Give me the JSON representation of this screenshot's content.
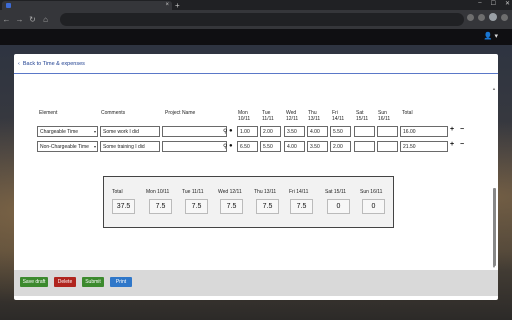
{
  "browser": {
    "tab_close": "×",
    "new_tab": "+"
  },
  "back_link": "Back to Time & expenses",
  "columns": {
    "element": "Element",
    "comments": "Comments",
    "project": "Project Name",
    "days": [
      {
        "day": "Mon",
        "date": "10/11"
      },
      {
        "day": "Tue",
        "date": "11/11"
      },
      {
        "day": "Wed",
        "date": "12/11"
      },
      {
        "day": "Thu",
        "date": "13/11"
      },
      {
        "day": "Fri",
        "date": "14/11"
      },
      {
        "day": "Sat",
        "date": "15/11"
      },
      {
        "day": "Sun",
        "date": "16/11"
      }
    ],
    "total": "Total"
  },
  "rows": [
    {
      "element": "Chargeable Time",
      "comment": "Some work I did",
      "project": "",
      "hours": [
        "1.00",
        "2.00",
        "3.50",
        "4.00",
        "5.50",
        "",
        ""
      ],
      "total": "16.00"
    },
    {
      "element": "Non-Chargeable Time",
      "comment": "Some training I did",
      "project": "",
      "hours": [
        "6.50",
        "5.50",
        "4.00",
        "3.50",
        "2.00",
        "",
        ""
      ],
      "total": "21.50"
    }
  ],
  "row_buttons": {
    "add": "+",
    "remove": "−"
  },
  "totals": {
    "labels": [
      "Total",
      "Mon 10/11",
      "Tue 11/11",
      "Wed 12/11",
      "Thu 13/11",
      "Fri 14/11",
      "Sat 15/11",
      "Sun 16/11"
    ],
    "values": [
      "37.5",
      "7.5",
      "7.5",
      "7.5",
      "7.5",
      "7.5",
      "0",
      "0"
    ]
  },
  "actions": {
    "save_draft": "Save draft",
    "delete": "Delete",
    "submit": "Submit",
    "print": "Print"
  },
  "colors": {
    "save_draft": "#3c8a2e",
    "delete": "#b0251f",
    "submit": "#3c8a2e",
    "print": "#2f77c9",
    "link": "#1c3d8f"
  }
}
